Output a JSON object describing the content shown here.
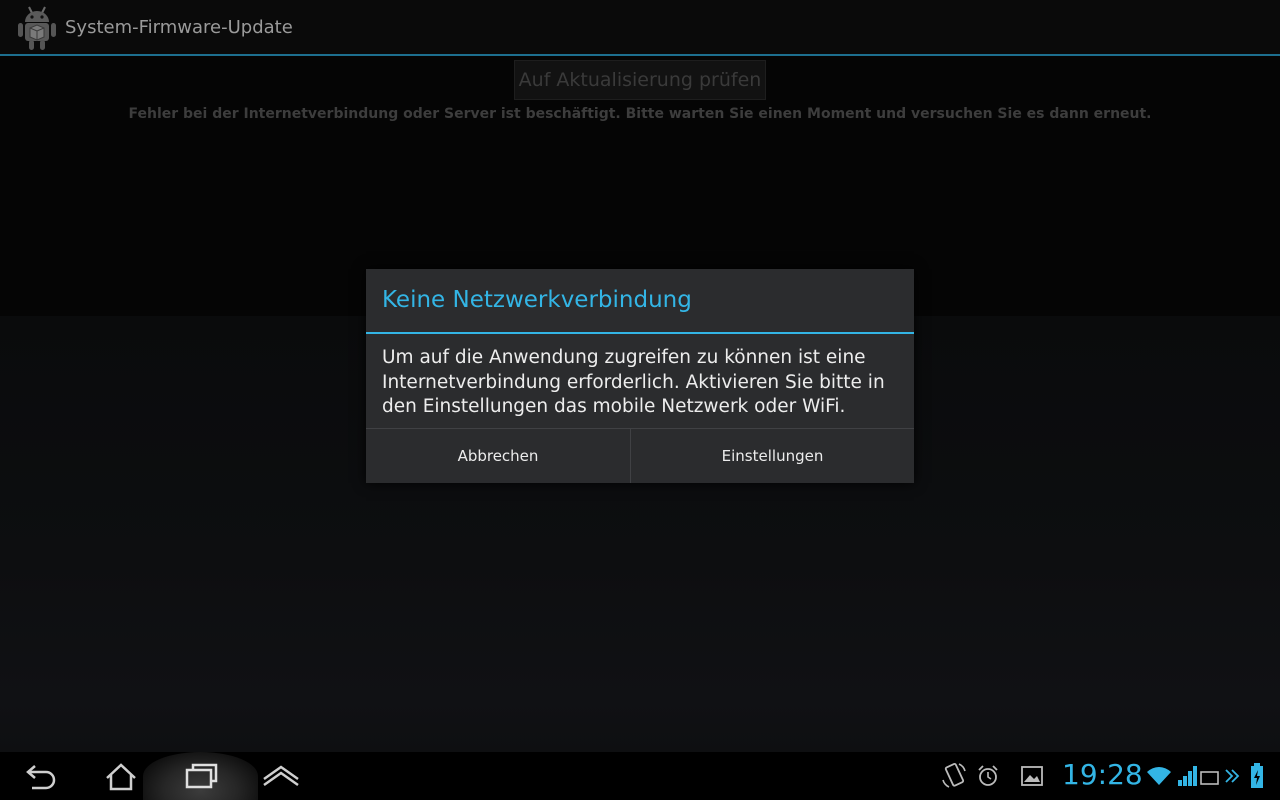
{
  "action_bar": {
    "title": "System-Firmware-Update",
    "app_icon": "android-package-icon"
  },
  "main": {
    "check_button_label": "Auf Aktualisierung prüfen",
    "error_message": "Fehler bei der Internetverbindung oder Server ist beschäftigt. Bitte warten Sie einen Moment und versuchen Sie es dann erneut."
  },
  "dialog": {
    "title": "Keine Netzwerkverbindung",
    "message": "Um auf die Anwendung zugreifen zu können ist eine Internetverbindung erforderlich. Aktivieren Sie bitte in den Einstellungen das mobile Netzwerk oder WiFi.",
    "cancel_label": "Abbrechen",
    "settings_label": "Einstellungen"
  },
  "system_bar": {
    "nav_icons": [
      "back-icon",
      "home-icon",
      "recent-apps-icon",
      "menu-up-icon"
    ],
    "status_icons": [
      "screen-rotation-icon",
      "alarm-icon",
      "gallery-icon",
      "wifi-icon",
      "signal-icon",
      "keyboard-icon",
      "expand-icon",
      "battery-icon"
    ],
    "clock": "19:28"
  },
  "colors": {
    "accent": "#33b5e5",
    "dialog_background": "#2b2c2e",
    "text_primary": "#ededed"
  }
}
